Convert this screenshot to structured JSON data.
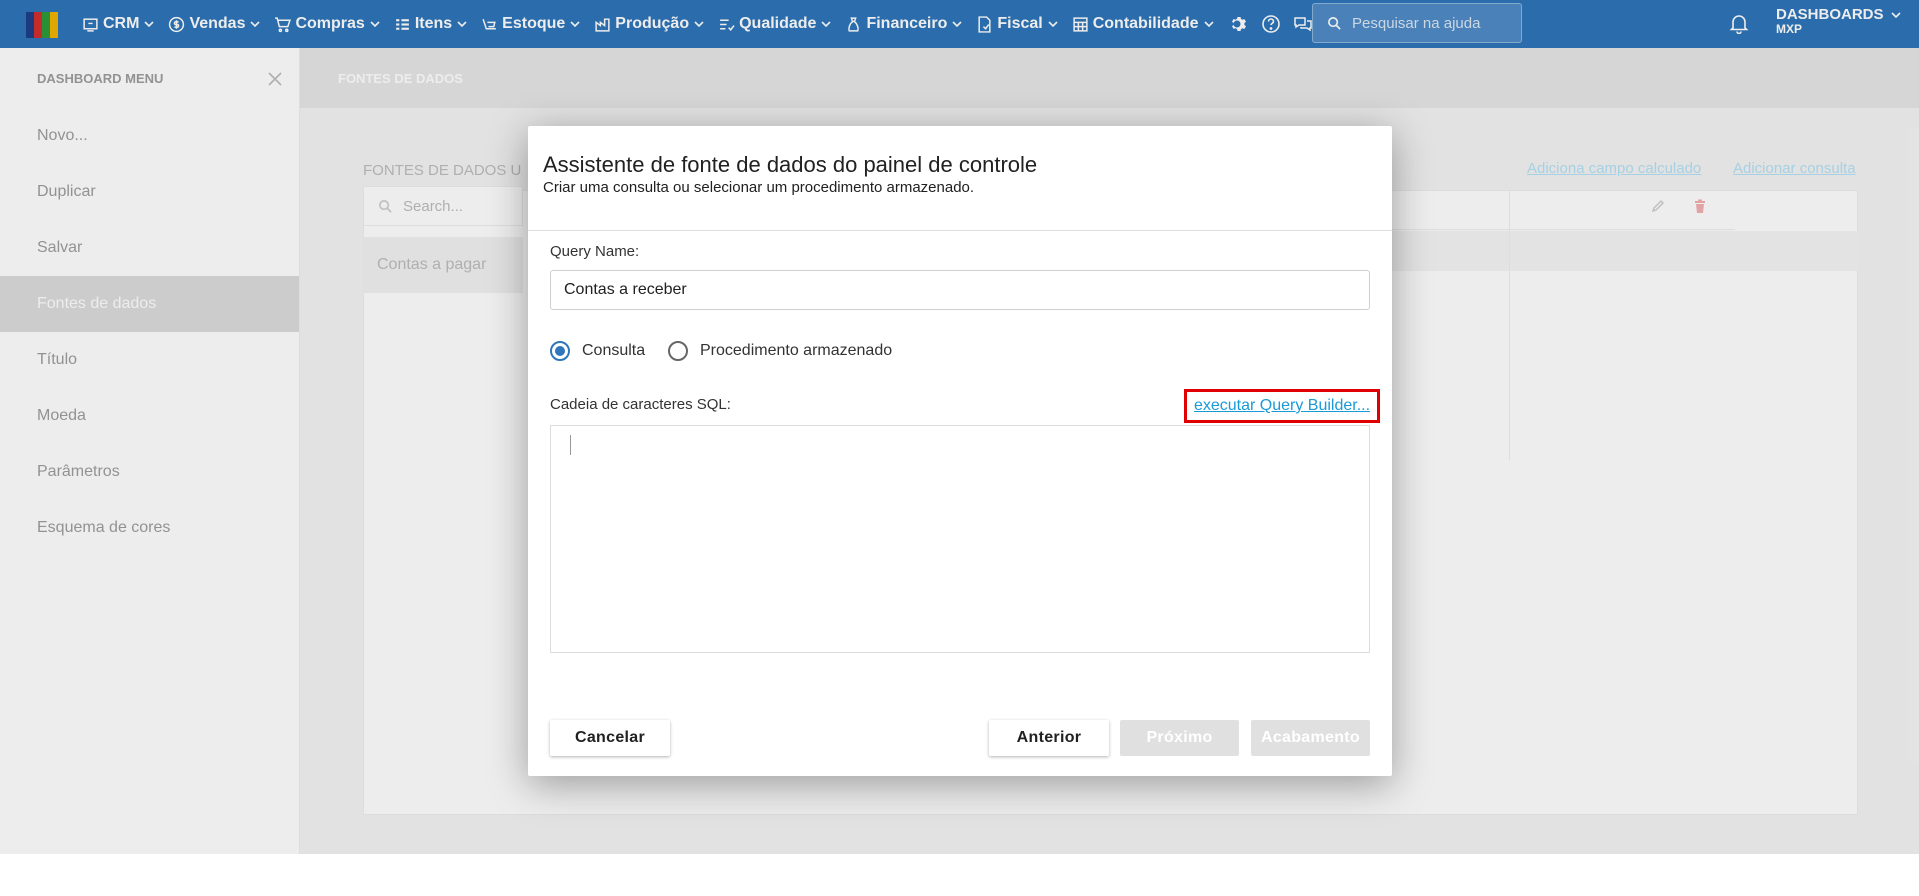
{
  "nav": {
    "items": [
      {
        "label": "CRM",
        "icon": "crm-icon"
      },
      {
        "label": "Vendas",
        "icon": "dollar-icon"
      },
      {
        "label": "Compras",
        "icon": "cart-icon"
      },
      {
        "label": "Itens",
        "icon": "items-icon"
      },
      {
        "label": "Estoque",
        "icon": "stock-icon"
      },
      {
        "label": "Produção",
        "icon": "production-icon"
      },
      {
        "label": "Qualidade",
        "icon": "quality-icon"
      },
      {
        "label": "Financeiro",
        "icon": "money-bag-icon"
      },
      {
        "label": "Fiscal",
        "icon": "fiscal-icon"
      },
      {
        "label": "Contabilidade",
        "icon": "calculator-icon"
      }
    ],
    "search_placeholder": "Pesquisar na ajuda",
    "account_title": "DASHBOARDS",
    "account_sub": "MXP"
  },
  "sidebar": {
    "title": "DASHBOARD MENU",
    "items": [
      {
        "label": "Novo..."
      },
      {
        "label": "Duplicar"
      },
      {
        "label": "Salvar"
      },
      {
        "label": "Fontes de dados"
      },
      {
        "label": "Título"
      },
      {
        "label": "Moeda"
      },
      {
        "label": "Parâmetros"
      },
      {
        "label": "Esquema de cores"
      }
    ],
    "active_index": 3
  },
  "main": {
    "header": "FONTES DE DADOS",
    "panel_title": "FONTES DE DADOS U",
    "link_calc": "Adiciona campo calculado",
    "link_add": "Adicionar consulta",
    "search_placeholder": "Search...",
    "row_label": "Contas a pagar"
  },
  "modal": {
    "title": "Assistente de fonte de dados do painel de controle",
    "subtitle": "Criar uma consulta ou selecionar um procedimento armazenado.",
    "query_name_label": "Query Name:",
    "query_name_value": "Contas a receber",
    "radio_query": "Consulta",
    "radio_proc": "Procedimento armazenado",
    "sql_label": "Cadeia de caracteres SQL:",
    "query_builder_link": "executar Query Builder...",
    "btn_cancel": "Cancelar",
    "btn_prev": "Anterior",
    "btn_next": "Próximo",
    "btn_finish": "Acabamento"
  },
  "colors": {
    "nav_bg": "#2f76ba",
    "accent": "#2f76ba",
    "link": "#1a9ad6",
    "highlight": "#e00000"
  }
}
